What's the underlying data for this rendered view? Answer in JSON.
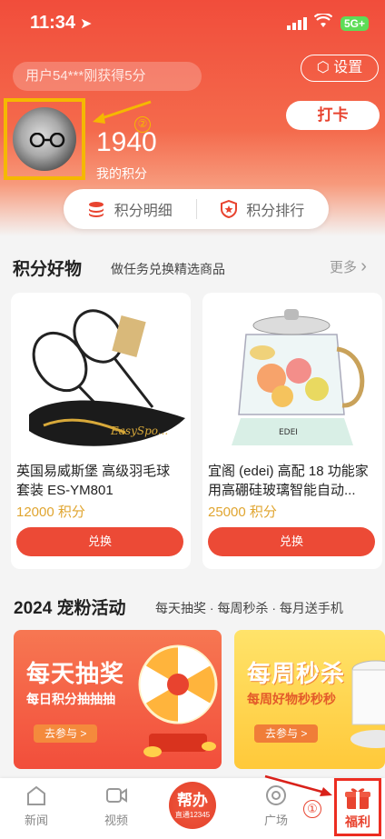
{
  "status_bar": {
    "time": "11:34",
    "network": "5G+"
  },
  "header": {
    "ticker": "用户54***刚获得5分",
    "settings_label": "设置",
    "checkin_label": "打卡",
    "step_marker": "②",
    "points": "1940",
    "points_label": "我的积分"
  },
  "tabs": [
    {
      "label": "积分明细",
      "icon": "coin-stack-icon"
    },
    {
      "label": "积分排行",
      "icon": "shield-star-icon"
    }
  ],
  "goods_section": {
    "title": "积分好物",
    "subtitle": "做任务兑换精选商品",
    "more_label": "更多"
  },
  "products": [
    {
      "name": "英国易威斯堡 高级羽毛球套装 ES-YM801",
      "price": "12000 积分",
      "button": "兑换",
      "image_caption": "EasySpo..."
    },
    {
      "name": "宜阁 (edei) 高配 18 功能家用高硼硅玻璃智能自动...",
      "price": "25000 积分",
      "button": "兑换",
      "image_caption": "EDEI"
    }
  ],
  "events_section": {
    "title": "2024 宠粉活动",
    "subtitle": "每天抽奖 · 每周秒杀 · 每月送手机"
  },
  "promos": [
    {
      "title": "每天抽奖",
      "subtitle": "每日积分抽抽抽",
      "button": "去参与 >"
    },
    {
      "title": "每周秒杀",
      "subtitle": "每周好物秒秒秒",
      "button": "去参与 >"
    }
  ],
  "bottom_nav": {
    "items": [
      {
        "label": "新闻",
        "icon": "news-icon"
      },
      {
        "label": "视频",
        "icon": "video-icon"
      },
      {
        "label": "广场",
        "icon": "plaza-icon"
      },
      {
        "label": "福利",
        "icon": "gift-icon"
      }
    ],
    "center_main": "帮办",
    "center_sub": "直通12345",
    "step_marker": "①"
  },
  "colors": {
    "brand_red": "#ec4a36",
    "highlight_yellow": "#f5b800",
    "price_gold": "#e0a530"
  }
}
